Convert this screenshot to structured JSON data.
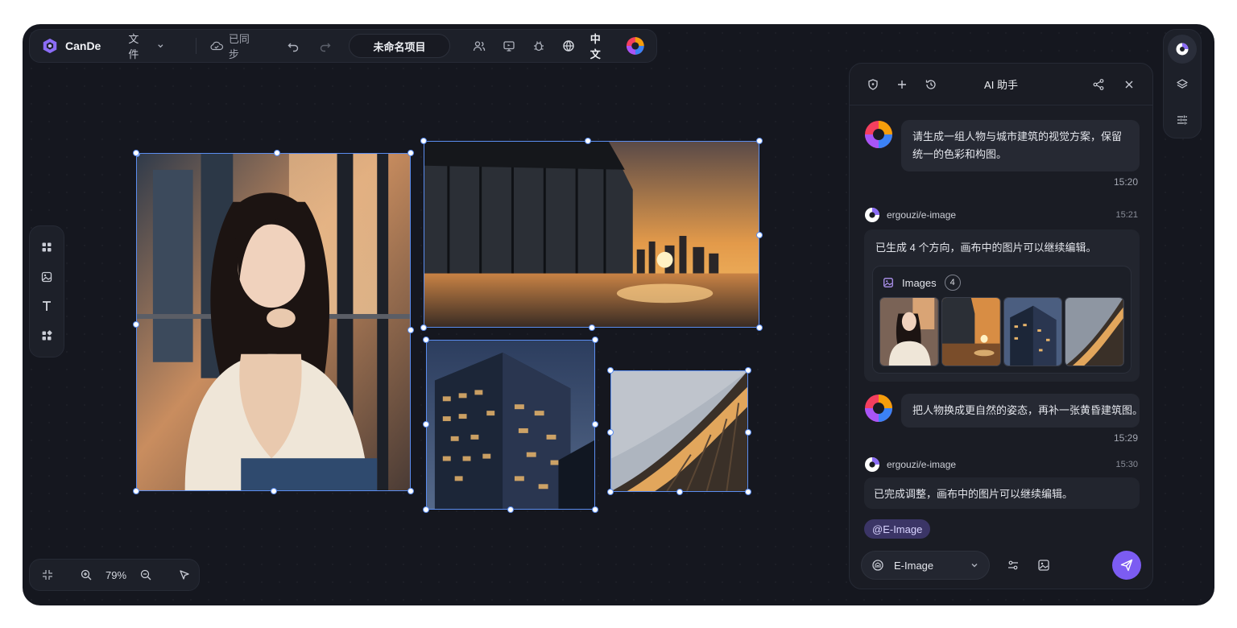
{
  "app": {
    "name": "CanDe"
  },
  "topbar": {
    "file_menu": "文件",
    "sync_status": "已同步",
    "project_name": "未命名项目",
    "language": "中文"
  },
  "zoom": {
    "level": "79%"
  },
  "ai_panel": {
    "title": "AI 助手",
    "messages": [
      {
        "role": "user",
        "text": "请生成一组人物与城市建筑的视觉方案，保留统一的色彩和构图。",
        "time": "15:20"
      },
      {
        "role": "bot",
        "sender": "ergouzi/e-image",
        "time": "15:21",
        "text": "已生成 4 个方向，画布中的图片可以继续编辑。",
        "images_label": "Images",
        "images_count": "4"
      },
      {
        "role": "user",
        "text": "把人物换成更自然的姿态，再补一张黄昏建筑图。",
        "time": "15:29"
      },
      {
        "role": "bot",
        "sender": "ergouzi/e-image",
        "time": "15:30",
        "text": "已完成调整，画布中的图片可以继续编辑。"
      }
    ],
    "mention": "@E-Image",
    "model": "E-Image"
  },
  "colors": {
    "accent": "#7c5cf2",
    "selection": "#5b8def",
    "background": "#15171f"
  }
}
